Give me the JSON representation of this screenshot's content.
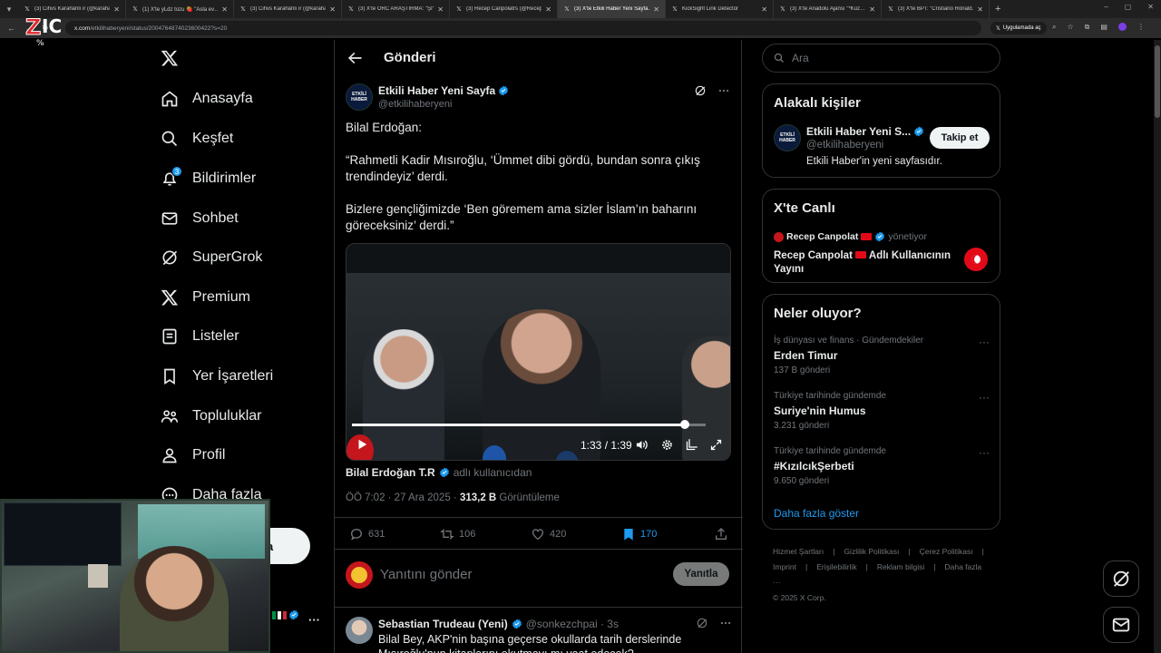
{
  "browser": {
    "tabs": [
      {
        "title": "(3) Cihvs Karahânli ır (@karahan…",
        "active": false
      },
      {
        "title": "(1) X'te yLdz tozu 🍓 \"Asla ev…",
        "active": false
      },
      {
        "title": "(3) Cihvs Karahânli ır (@karahan…",
        "active": false
      },
      {
        "title": "(3) X'te ORC ARAŞTIRMA: \"ŞİYA…",
        "active": false
      },
      {
        "title": "(3) Recep Canpolatrs (@Recep…",
        "active": false
      },
      {
        "title": "(3) X'te Etkili Haber Yeni Sayfa…",
        "active": true
      },
      {
        "title": "KickSight Link Detector",
        "active": false
      },
      {
        "title": "(3) X'te Anadolu Ajansı \"*Kuz…",
        "active": false
      },
      {
        "title": "(3) X'te BPT: \"Cristiano Ronald…",
        "active": false
      }
    ],
    "url_host": "x.com",
    "url_path": "/etkilihaberyeni/status/2004764874023600422?s=20",
    "app_pill": "Uygulamada aç"
  },
  "overlay": {
    "logo_text": "ZIC",
    "logo_sub": "%"
  },
  "nav": {
    "items": [
      {
        "label": "Anasayfa",
        "icon": "home-icon"
      },
      {
        "label": "Keşfet",
        "icon": "search-icon"
      },
      {
        "label": "Bildirimler",
        "icon": "bell-icon",
        "badge": "3"
      },
      {
        "label": "Sohbet",
        "icon": "mail-icon"
      },
      {
        "label": "SuperGrok",
        "icon": "grok-icon"
      },
      {
        "label": "Premium",
        "icon": "x-logo-icon"
      },
      {
        "label": "Listeler",
        "icon": "list-icon"
      },
      {
        "label": "Yer İşaretleri",
        "icon": "bookmark-icon"
      },
      {
        "label": "Topluluklar",
        "icon": "communities-icon"
      },
      {
        "label": "Profil",
        "icon": "profile-icon"
      },
      {
        "label": "Daha fazla",
        "icon": "more-circle-icon"
      }
    ],
    "post_label": "a",
    "more_label": "···"
  },
  "center": {
    "header_title": "Gönderi",
    "author": {
      "name": "Etkili Haber Yeni Sayfa",
      "handle": "@etkilihaberyeni",
      "avatar_text": "ETKİLİ HABER"
    },
    "tweet_paragraphs": [
      "Bilal Erdoğan:",
      "“Rahmetli Kadir Mısıroğlu, ‘Ümmet dibi gördü, bundan sonra çıkış trendindeyiz’ derdi.",
      "Bizlere gençliğimizde ‘Ben göremem ama sizler İslam’ın baharını göreceksiniz’ derdi.”"
    ],
    "video": {
      "time": "1:33 / 1:39",
      "progress": 0.94
    },
    "credit": {
      "name": "Bilal Erdoğan T.R",
      "suffix": "adlı kullanıcıdan"
    },
    "meta": {
      "time": "ÖÖ 7:02 · 27 Ara 2025 · ",
      "views": "313,2 B",
      "views_label": " Görüntüleme"
    },
    "actions": {
      "replies": "631",
      "reposts": "106",
      "likes": "420",
      "bookmarks": "170"
    },
    "reply_placeholder": "Yanıtını gönder",
    "reply_button": "Yanıtla",
    "reply_tweet": {
      "name": "Sebastian Trudeau (Yeni)",
      "handle": "@sonkezchpai · 3s",
      "text": "Bilal Bey, AKP'nin başına geçerse okullarda tarih derslerinde Mısıroğlu'nun kitaplarını okutmayı mı vaat edecek?"
    }
  },
  "right": {
    "search_placeholder": "Ara",
    "related": {
      "title": "Alakalı kişiler",
      "name": "Etkili Haber Yeni S...",
      "handle": "@etkilihaberyeni",
      "bio": "Etkili Haber'in yeni sayfasıdır.",
      "follow": "Takip et",
      "avatar_text": "ETKİLİ HABER"
    },
    "live": {
      "title": "X'te Canlı",
      "host": "Recep Canpolat",
      "role": "yönetiyor",
      "stream_title_a": "Recep Canpolat",
      "stream_title_b": " Adlı Kullanıcının Yayını"
    },
    "trends": {
      "title": "Neler oluyor?",
      "items": [
        {
          "category": "İş dünyası ve finans · Gündemdekiler",
          "title": "Erden Timur",
          "count": "137 B gönderi"
        },
        {
          "category": "Türkiye tarihinde gündemde",
          "title": "Suriye'nin Humus",
          "count": "3.231 gönderi"
        },
        {
          "category": "Türkiye tarihinde gündemde",
          "title": "#KızılcıkŞerbeti",
          "count": "9.650 gönderi"
        }
      ],
      "show_more": "Daha fazla göster"
    },
    "footer": {
      "line1": [
        "Hizmet Şartları",
        "|",
        "Gizlilik Politikası",
        "|",
        "Çerez Politikası",
        "|"
      ],
      "line2": [
        "Imprint",
        "|",
        "Erişilebilirlik",
        "|",
        "Reklam bilgisi",
        "|",
        "Daha fazla ···"
      ],
      "line3": "© 2025 X Corp."
    }
  },
  "colors": {
    "accent": "#1d9bf0",
    "background": "#000000",
    "border": "#2f3336",
    "muted": "#71767b",
    "text": "#e7e9ea"
  }
}
